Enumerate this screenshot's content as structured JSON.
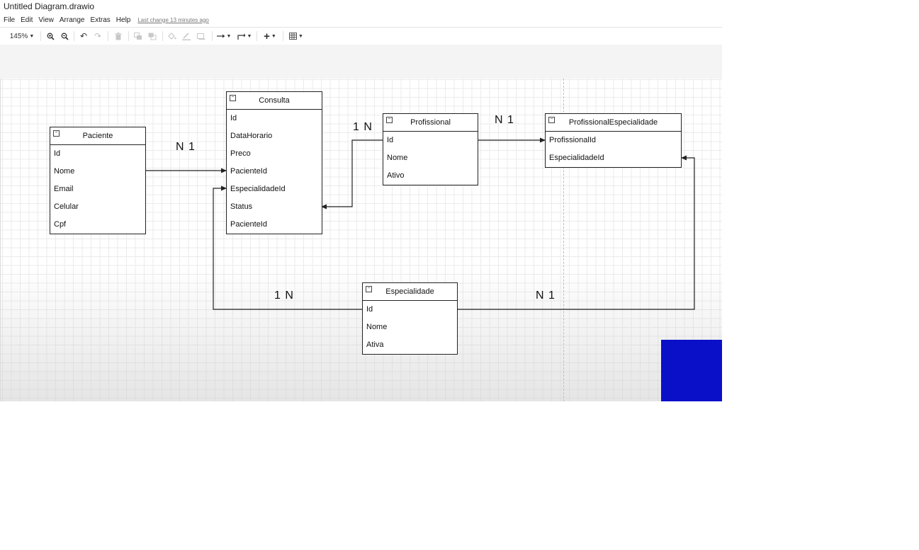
{
  "window": {
    "title": "Untitled Diagram.drawio"
  },
  "menu": {
    "items": [
      "File",
      "Edit",
      "View",
      "Arrange",
      "Extras",
      "Help"
    ],
    "last_change": "Last change 13 minutes ago"
  },
  "toolbar": {
    "zoom": "145%"
  },
  "entities": {
    "paciente": {
      "title": "Paciente",
      "fields": [
        "Id",
        "Nome",
        "Email",
        "Celular",
        "Cpf"
      ]
    },
    "consulta": {
      "title": "Consulta",
      "fields": [
        "Id",
        "DataHorario",
        "Preco",
        "PacienteId",
        "EspecialidadeId",
        "Status",
        "PacienteId"
      ]
    },
    "profissional": {
      "title": "Profissional",
      "fields": [
        "Id",
        "Nome",
        "Ativo"
      ]
    },
    "profissional_especialidade": {
      "title": "ProfissionalEspecialidade",
      "fields": [
        "ProfissionalId",
        "EspecialidadeId"
      ]
    },
    "especialidade": {
      "title": "Especialidade",
      "fields": [
        "Id",
        "Nome",
        "Ativa"
      ]
    }
  },
  "cardinalities": {
    "paciente_consulta": "N 1",
    "profissional_consulta": "1 N",
    "profissional_especialidade": "N 1",
    "especialidade_consulta": "1 N",
    "especialidade_profesp": "N 1"
  },
  "colors": {
    "overlay_blue": "#0a10c8",
    "line": "#222222",
    "grid": "#ebebeb"
  }
}
